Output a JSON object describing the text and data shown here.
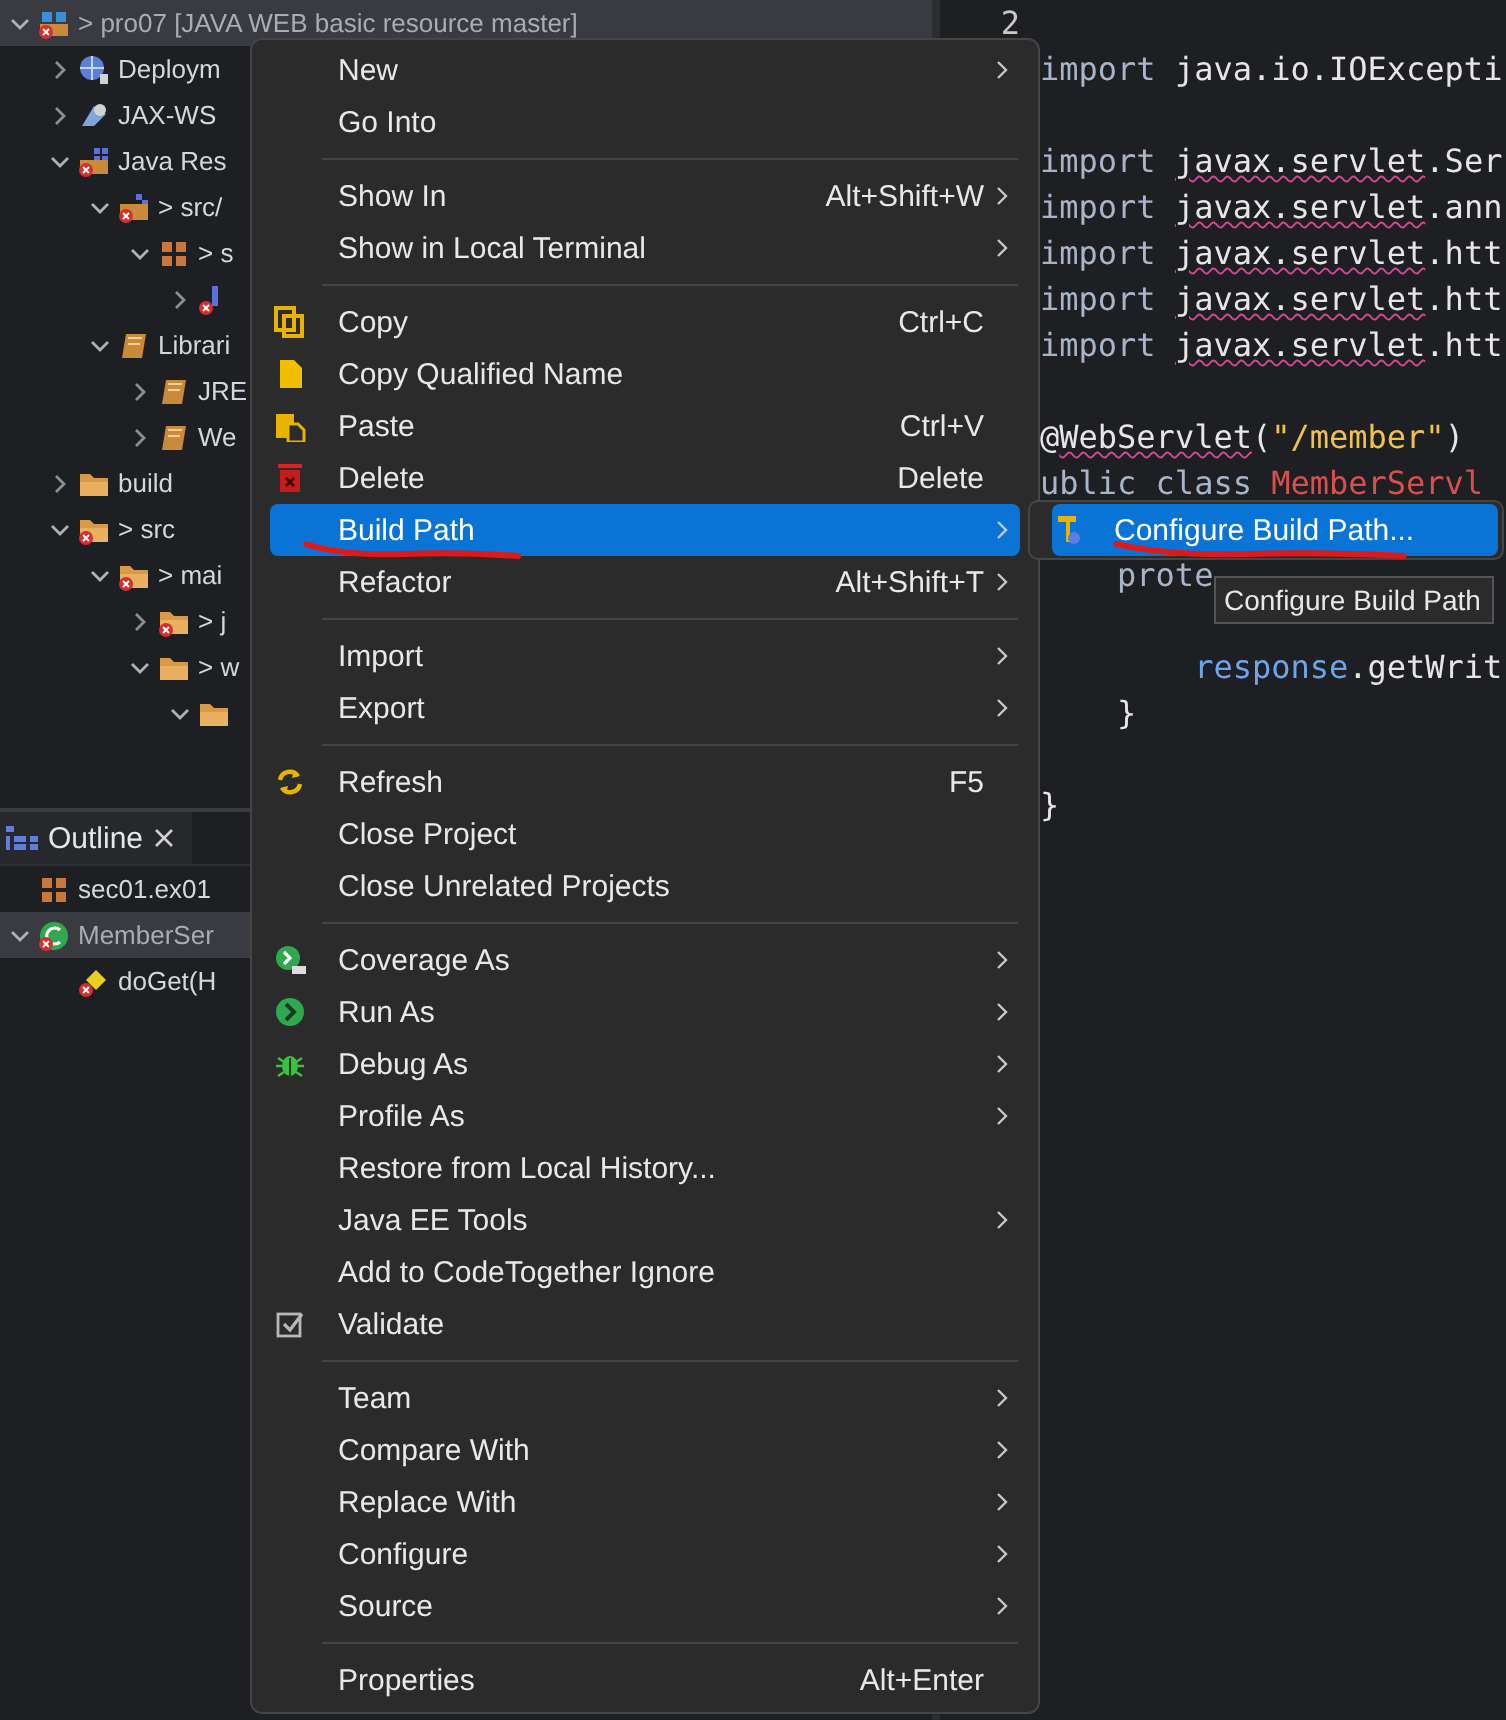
{
  "explorer": {
    "tree": [
      {
        "label": "> pro07 [JAVA WEB basic resource master]",
        "kind": "project",
        "expanded": true,
        "selected": true,
        "children": [
          {
            "label": "Deploym",
            "kind": "globe",
            "expanded": false,
            "selected": false
          },
          {
            "label": "JAX-WS",
            "kind": "webservice",
            "expanded": false,
            "selected": false
          },
          {
            "label": "Java Res",
            "kind": "resources",
            "expanded": true,
            "selected": false,
            "children": [
              {
                "label": "> src/",
                "kind": "source-folder",
                "expanded": true,
                "selected": false,
                "children": [
                  {
                    "label": "> s",
                    "kind": "package",
                    "expanded": true,
                    "selected": false,
                    "children": [
                      {
                        "kind": "java-file",
                        "expanded": false,
                        "selected": false
                      }
                    ]
                  }
                ]
              },
              {
                "label": "Librari",
                "kind": "library",
                "expanded": true,
                "selected": false,
                "children": [
                  {
                    "label": "JRE",
                    "kind": "library",
                    "expanded": false,
                    "selected": false
                  },
                  {
                    "label": "We",
                    "kind": "library",
                    "expanded": false,
                    "selected": false
                  }
                ]
              }
            ]
          },
          {
            "label": "build",
            "kind": "folder",
            "expanded": false,
            "selected": false
          },
          {
            "label": "> src",
            "kind": "folder-error",
            "expanded": true,
            "selected": false,
            "children": [
              {
                "label": "> mai",
                "kind": "folder-error",
                "expanded": true,
                "selected": false,
                "children": [
                  {
                    "label": "> j",
                    "kind": "folder-error",
                    "expanded": false,
                    "selected": false
                  },
                  {
                    "label": "> w",
                    "kind": "folder",
                    "expanded": true,
                    "selected": false,
                    "children": [
                      {
                        "kind": "folder",
                        "expanded": true,
                        "selected": false
                      }
                    ]
                  }
                ]
              }
            ]
          }
        ]
      }
    ]
  },
  "outline": {
    "tab": {
      "label": "Outline",
      "selected": true
    },
    "tree": [
      {
        "label": "sec01.ex01",
        "kind": "package",
        "selected": false
      },
      {
        "label": "MemberSer",
        "kind": "class",
        "expanded": true,
        "selected": true,
        "children": [
          {
            "label": "doGet(H",
            "kind": "method",
            "selected": false
          }
        ]
      }
    ]
  },
  "editor": {
    "line_number": "2",
    "blocks": [
      [
        [
          {
            "text": "import ",
            "kind": "keyword"
          },
          {
            "text": "java.io.IOExcepti",
            "kind": "plain"
          }
        ]
      ],
      [
        [
          {
            "text": "import ",
            "kind": "keyword"
          },
          {
            "text": "javax.servlet",
            "kind": "error"
          },
          {
            "text": ".Ser",
            "kind": "plain"
          }
        ],
        [
          {
            "text": "import ",
            "kind": "keyword"
          },
          {
            "text": "javax.servlet",
            "kind": "error"
          },
          {
            "text": ".ann",
            "kind": "plain"
          }
        ],
        [
          {
            "text": "import ",
            "kind": "keyword"
          },
          {
            "text": "javax.servlet",
            "kind": "error"
          },
          {
            "text": ".htt",
            "kind": "plain"
          }
        ],
        [
          {
            "text": "import ",
            "kind": "keyword"
          },
          {
            "text": "javax.servlet",
            "kind": "error"
          },
          {
            "text": ".htt",
            "kind": "plain"
          }
        ],
        [
          {
            "text": "import ",
            "kind": "keyword"
          },
          {
            "text": "javax.servlet",
            "kind": "error"
          },
          {
            "text": ".htt",
            "kind": "plain"
          }
        ]
      ],
      [
        [
          {
            "text": "@",
            "kind": "plain"
          },
          {
            "text": "WebServlet",
            "kind": "error"
          },
          {
            "text": "(",
            "kind": "plain"
          },
          {
            "text": "\"/member\"",
            "kind": "string"
          },
          {
            "text": ")",
            "kind": "plain"
          }
        ],
        [
          {
            "text": "ublic class ",
            "kind": "keyword"
          },
          {
            "text": "MemberServl",
            "kind": "classname"
          }
        ]
      ],
      [
        [
          {
            "text": "    prote",
            "kind": "keyword"
          }
        ]
      ],
      [
        [
          {
            "text": "        response",
            "kind": "variable"
          },
          {
            "text": ".getWrit",
            "kind": "plain"
          }
        ],
        [
          {
            "text": "    }",
            "kind": "plain"
          }
        ]
      ],
      [
        [
          {
            "text": "}",
            "kind": "plain"
          }
        ]
      ]
    ]
  },
  "context_menu": {
    "groups": [
      [
        {
          "label": "New",
          "submenu": true,
          "selected": false
        },
        {
          "label": "Go Into",
          "selected": false
        }
      ],
      [
        {
          "label": "Show In",
          "shortcut": "Alt+Shift+W",
          "submenu": true,
          "selected": false
        },
        {
          "label": "Show in Local Terminal",
          "submenu": true,
          "selected": false
        }
      ],
      [
        {
          "label": "Copy",
          "kind": "copy",
          "shortcut": "Ctrl+C",
          "selected": false
        },
        {
          "label": "Copy Qualified Name",
          "kind": "page",
          "selected": false
        },
        {
          "label": "Paste",
          "kind": "paste",
          "shortcut": "Ctrl+V",
          "selected": false
        },
        {
          "label": "Delete",
          "kind": "trash",
          "shortcut": "Delete",
          "selected": false
        },
        {
          "label": "Build Path",
          "submenu": true,
          "selected": true,
          "underlined": true
        },
        {
          "label": "Refactor",
          "shortcut": "Alt+Shift+T",
          "submenu": true,
          "selected": false
        }
      ],
      [
        {
          "label": "Import",
          "submenu": true,
          "selected": false
        },
        {
          "label": "Export",
          "submenu": true,
          "selected": false
        }
      ],
      [
        {
          "label": "Refresh",
          "kind": "refresh",
          "shortcut": "F5",
          "selected": false
        },
        {
          "label": "Close Project",
          "selected": false
        },
        {
          "label": "Close Unrelated Projects",
          "selected": false
        }
      ],
      [
        {
          "label": "Coverage As",
          "kind": "coverage",
          "submenu": true,
          "selected": false
        },
        {
          "label": "Run As",
          "kind": "run",
          "submenu": true,
          "selected": false
        },
        {
          "label": "Debug As",
          "kind": "bug",
          "submenu": true,
          "selected": false
        },
        {
          "label": "Profile As",
          "submenu": true,
          "selected": false
        },
        {
          "label": "Restore from Local History...",
          "selected": false
        },
        {
          "label": "Java EE Tools",
          "submenu": true,
          "selected": false
        },
        {
          "label": "Add to CodeTogether Ignore",
          "selected": false
        },
        {
          "label": "Validate",
          "kind": "check",
          "selected": false
        }
      ],
      [
        {
          "label": "Team",
          "submenu": true,
          "selected": false
        },
        {
          "label": "Compare With",
          "submenu": true,
          "selected": false
        },
        {
          "label": "Replace With",
          "submenu": true,
          "selected": false
        },
        {
          "label": "Configure",
          "submenu": true,
          "selected": false
        },
        {
          "label": "Source",
          "submenu": true,
          "selected": false
        }
      ],
      [
        {
          "label": "Properties",
          "shortcut": "Alt+Enter",
          "selected": false
        }
      ]
    ]
  },
  "submenu": {
    "items": [
      {
        "label": "Configure Build Path...",
        "kind": "hammer",
        "selected": true,
        "underlined": true
      }
    ]
  },
  "tooltip": {
    "text": "Configure Build Path"
  }
}
